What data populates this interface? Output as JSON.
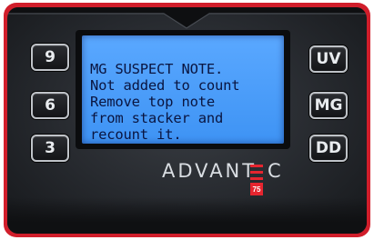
{
  "keypad": {
    "left_keys": [
      "9",
      "6",
      "3"
    ],
    "right_keys": [
      "UV",
      "MG",
      "DD"
    ]
  },
  "display": {
    "lines": [
      "MG SUSPECT NOTE.",
      "Not added to count",
      "Remove top note",
      "from stacker and",
      "recount it."
    ]
  },
  "branding": {
    "logo_text": "ADVANT",
    "logo_tail": "C",
    "model_badge": "75"
  },
  "colors": {
    "frame": "#d11e2b",
    "lcd_background": "#4a9cf9",
    "lcd_text": "#0a1540",
    "accent_red": "#e6252f"
  }
}
